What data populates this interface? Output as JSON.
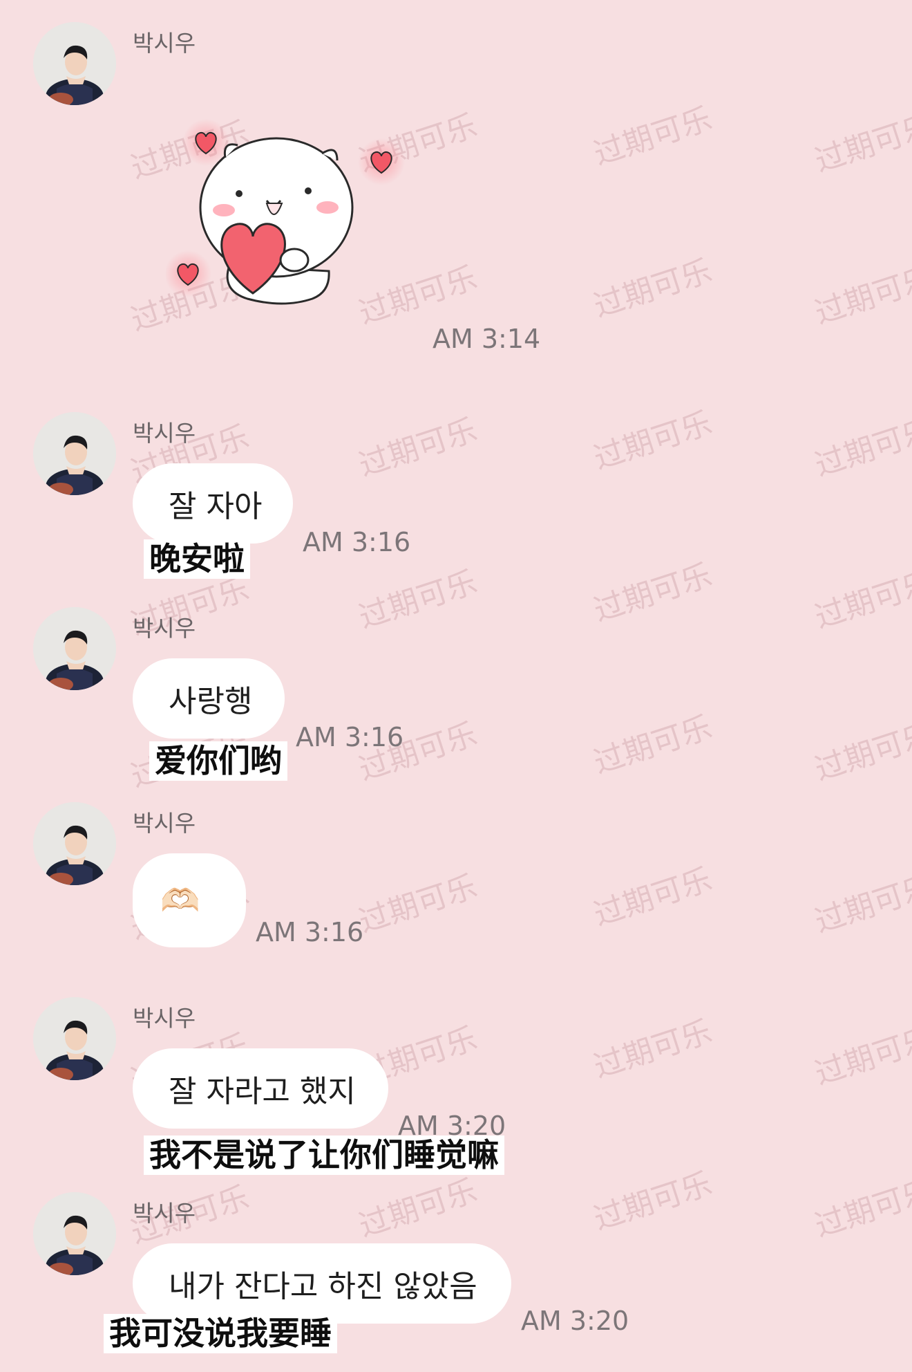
{
  "watermark": "过期可乐",
  "messages": [
    {
      "sender": "박시우",
      "type": "sticker",
      "sticker": "cat-with-heart",
      "time": "AM 3:14"
    },
    {
      "sender": "박시우",
      "text": "잘 자아",
      "time": "AM 3:16",
      "caption": "晚安啦"
    },
    {
      "sender": "박시우",
      "text": "사랑행",
      "time": "AM 3:16",
      "caption": "爱你们哟"
    },
    {
      "sender": "박시우",
      "text": "🫶🏻",
      "time": "AM 3:16"
    },
    {
      "sender": "박시우",
      "text": "잘 자라고 했지",
      "time": "AM 3:20",
      "caption": "我不是说了让你们睡觉嘛"
    },
    {
      "sender": "박시우",
      "text": "내가 잔다고 하진 않았음",
      "time": "AM 3:20",
      "caption": "我可没说我要睡"
    }
  ],
  "colors": {
    "background": "#f7dfe1",
    "bubble": "#ffffff",
    "time": "#7c7578",
    "sender": "#6a6466"
  }
}
